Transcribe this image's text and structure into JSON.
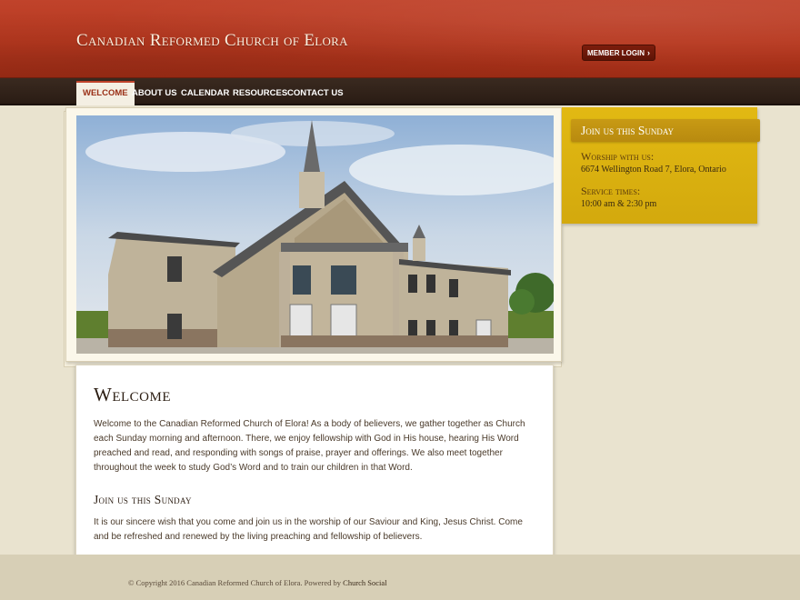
{
  "header": {
    "site_title": "Canadian Reformed Church of Elora",
    "member_login": "MEMBER LOGIN"
  },
  "nav": {
    "items": [
      "WELCOME",
      "ABOUT US",
      "CALENDAR",
      "RESOURCES",
      "CONTACT US"
    ],
    "active": "WELCOME"
  },
  "sidebar": {
    "heading": "Join us this Sunday",
    "worship_label": "Worship with us:",
    "address": "6674 Wellington Road 7, Elora, Ontario",
    "service_label": "Service times:",
    "times": "10:00 am & 2:30 pm"
  },
  "content": {
    "title": "Welcome",
    "body": "Welcome to the Canadian Reformed Church of Elora! As a body of believers, we gather together as Church each Sunday morning and afternoon. There, we enjoy fellowship with God in His house, hearing His Word preached and read, and responding with songs of praise, prayer and offerings. We also meet together throughout the week to study God’s Word and to train our children in that Word.",
    "join_heading": "Join us this Sunday",
    "join_body": "It is our sincere wish that you come and join us in the worship of our Saviour and King, Jesus Christ. Come and be refreshed and renewed by the living preaching and fellowship of believers."
  },
  "footer": {
    "text": "© Copyright 2016 Canadian Reformed Church of Elora. Powered by",
    "link": "Church Social"
  },
  "colors": {
    "header_red": "#b7381f",
    "nav_brown": "#2a1c14",
    "sidebar_gold": "#e2b913",
    "background": "#e9e3cf"
  }
}
